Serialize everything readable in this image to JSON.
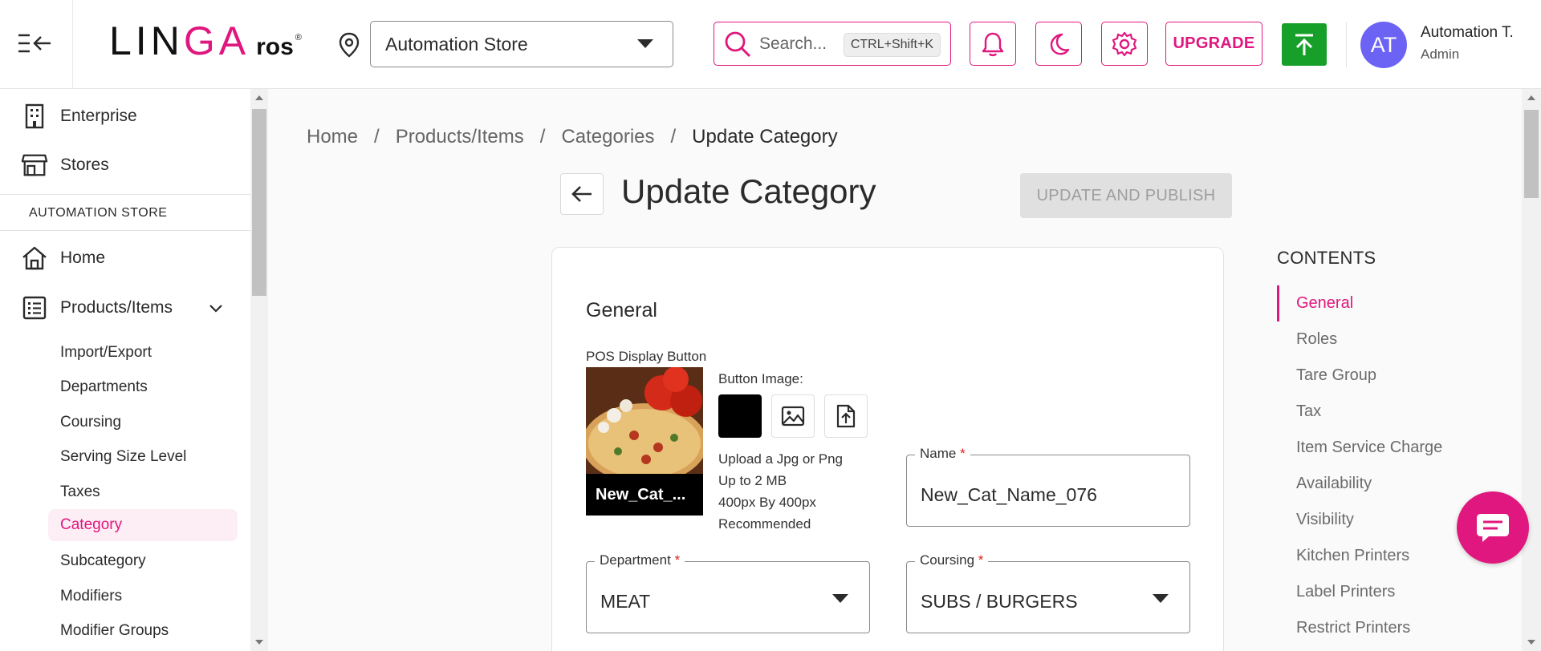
{
  "header": {
    "logo_main_a": "LIN",
    "logo_main_b": "GA",
    "logo_ros": "ros",
    "logo_reg": "®",
    "store_select_value": "Automation Store",
    "search_placeholder": "Search...",
    "search_shortcut": "CTRL+Shift+K",
    "upgrade_label": "UPGRADE",
    "avatar_initials": "AT",
    "user_name": "Automation T.",
    "user_role": "Admin",
    "accent_color": "#e0177e",
    "publish_color": "#16a02a"
  },
  "sidebar": {
    "top_items": [
      {
        "label": "Enterprise",
        "icon": "building-icon"
      },
      {
        "label": "Stores",
        "icon": "store-icon"
      }
    ],
    "section_title": "AUTOMATION STORE",
    "items": [
      {
        "label": "Home",
        "icon": "home-icon"
      },
      {
        "label": "Products/Items",
        "icon": "list-icon"
      }
    ],
    "sub_items": [
      "Import/Export",
      "Departments",
      "Coursing",
      "Serving Size Level",
      "Taxes",
      "Category",
      "Subcategory",
      "Modifiers",
      "Modifier Groups"
    ],
    "active_sub_item": "Category"
  },
  "breadcrumb": {
    "items": [
      "Home",
      "Products/Items",
      "Categories"
    ],
    "current": "Update Category"
  },
  "page": {
    "title": "Update Category",
    "update_publish_label": "UPDATE AND PUBLISH"
  },
  "general": {
    "section_title": "General",
    "pos_display_label": "POS Display Button",
    "pos_caption": "New_Cat_...",
    "button_image_label": "Button Image:",
    "upload_lines": [
      "Upload a Jpg or Png",
      "Up to 2 MB",
      "400px By 400px",
      "Recommended"
    ],
    "name_label": "Name",
    "name_value": "New_Cat_Name_076",
    "department_label": "Department",
    "department_value": "MEAT",
    "coursing_label": "Coursing",
    "coursing_value": "SUBS / BURGERS",
    "required_mark": "*"
  },
  "contents": {
    "title": "CONTENTS",
    "items": [
      "General",
      "Roles",
      "Tare Group",
      "Tax",
      "Item Service Charge",
      "Availability",
      "Visibility",
      "Kitchen Printers",
      "Label Printers",
      "Restrict Printers"
    ],
    "active": "General"
  }
}
